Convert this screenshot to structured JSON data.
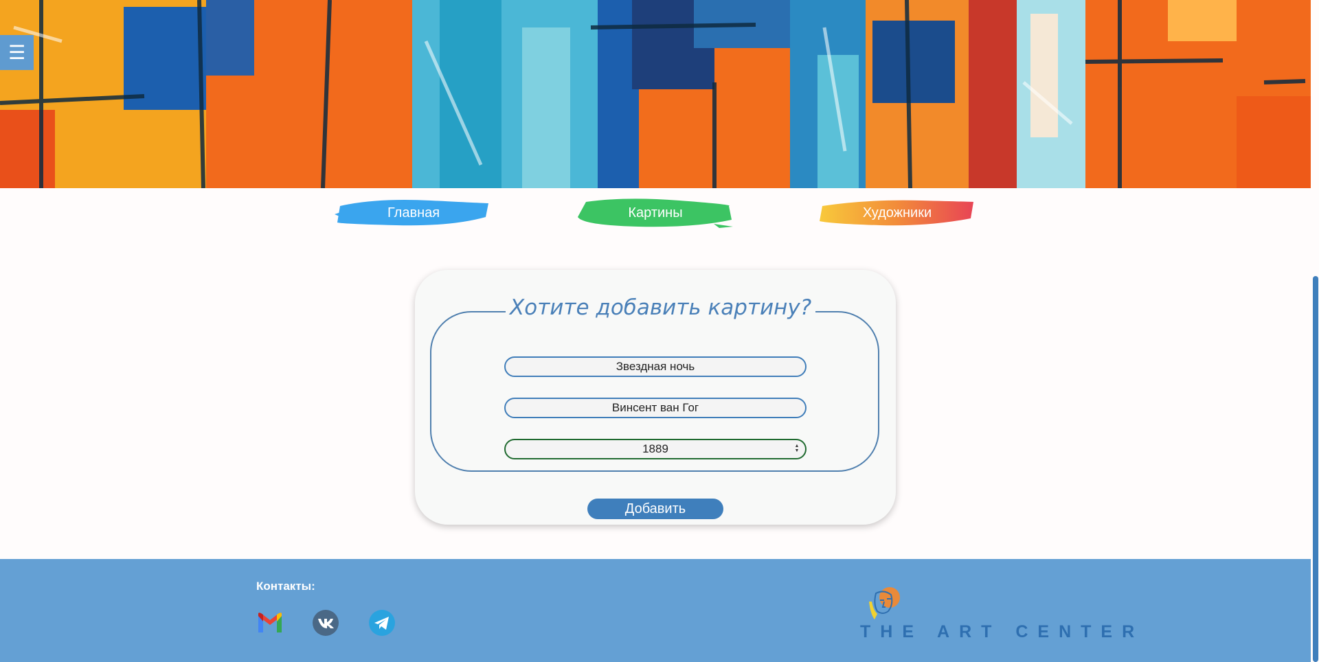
{
  "header": {
    "menu_icon": "☰"
  },
  "nav": {
    "items": [
      {
        "label": "Главная",
        "color": "#3aa5ee"
      },
      {
        "label": "Картины",
        "color": "#3cc463"
      },
      {
        "label": "Художники",
        "color": "#f2a03a"
      }
    ]
  },
  "form": {
    "legend": "Хотите добавить картину?",
    "painting_value": "Звездная ночь",
    "artist_value": "Винсент ван Гог",
    "year_value": "1889",
    "submit_label": "Добавить"
  },
  "footer": {
    "contacts_title": "Контакты:",
    "social_icons": [
      "gmail-icon",
      "vk-icon",
      "telegram-icon"
    ],
    "logo_text": "THE ART CENTER"
  },
  "colors": {
    "accent": "#3f7fbc",
    "footer_bg": "#64a0d4"
  }
}
